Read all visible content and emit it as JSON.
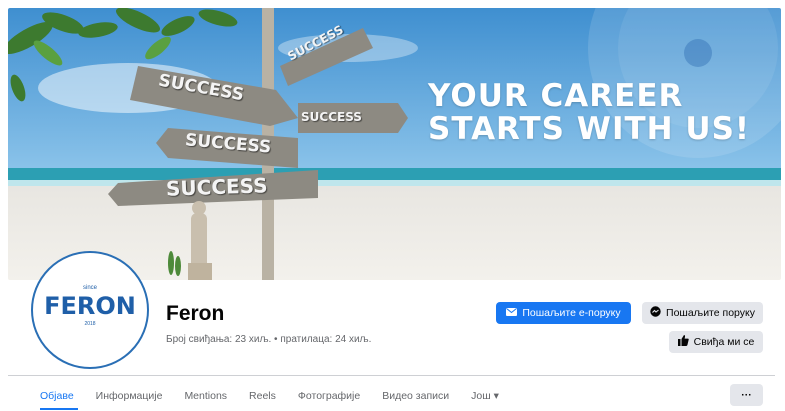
{
  "cover": {
    "headline_line1": "YOUR CAREER",
    "headline_line2": "STARTS WITH US!",
    "signs": [
      "SUCCESS",
      "SUCCESS",
      "SUCCESS",
      "SUCCESS",
      "SUCCESS"
    ]
  },
  "logo": {
    "wordmark": "FERON",
    "since": "since",
    "year": "2018"
  },
  "page": {
    "name": "Feron",
    "stats": "Број свиђања: 23 хиљ. • пратилаца: 24 хиљ."
  },
  "actions": {
    "email_label": "Пошаљите е-поруку",
    "message_label": "Пошаљите поруку",
    "like_label": "Свиђа ми се",
    "more_label": "···"
  },
  "tabs": [
    {
      "label": "Објаве"
    },
    {
      "label": "Информације"
    },
    {
      "label": "Mentions"
    },
    {
      "label": "Reels"
    },
    {
      "label": "Фотографије"
    },
    {
      "label": "Видео записи"
    },
    {
      "label": "Још ▾"
    }
  ],
  "colors": {
    "accent": "#1877f2",
    "logo_blue": "#1f5fa8"
  },
  "icons": {
    "email": "envelope-icon",
    "messenger": "messenger-icon",
    "like": "thumbs-up-icon",
    "more": "ellipsis-icon"
  }
}
